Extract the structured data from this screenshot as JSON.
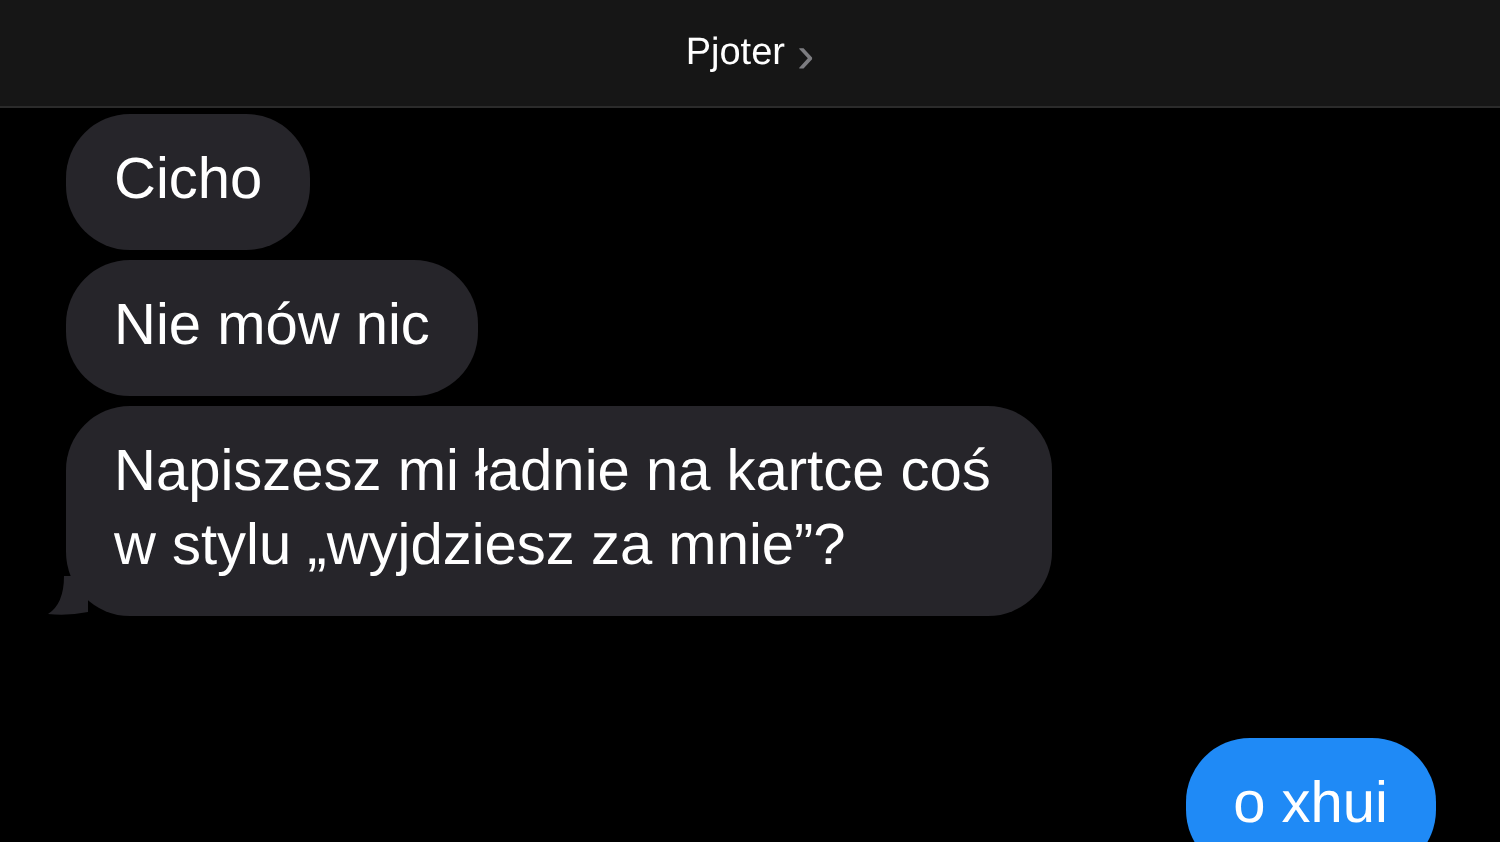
{
  "header": {
    "contact_name": "Pjoter",
    "chevron": "›"
  },
  "messages": [
    {
      "kind": "incoming",
      "text": "Cicho",
      "tail": false
    },
    {
      "kind": "incoming",
      "text": "Nie mów nic",
      "tail": false
    },
    {
      "kind": "incoming",
      "text": "Napiszesz mi ładnie na kartce coś w stylu „wyjdziesz za mnie”?",
      "tail": true
    },
    {
      "kind": "outgoing",
      "text": "o xhui"
    }
  ]
}
